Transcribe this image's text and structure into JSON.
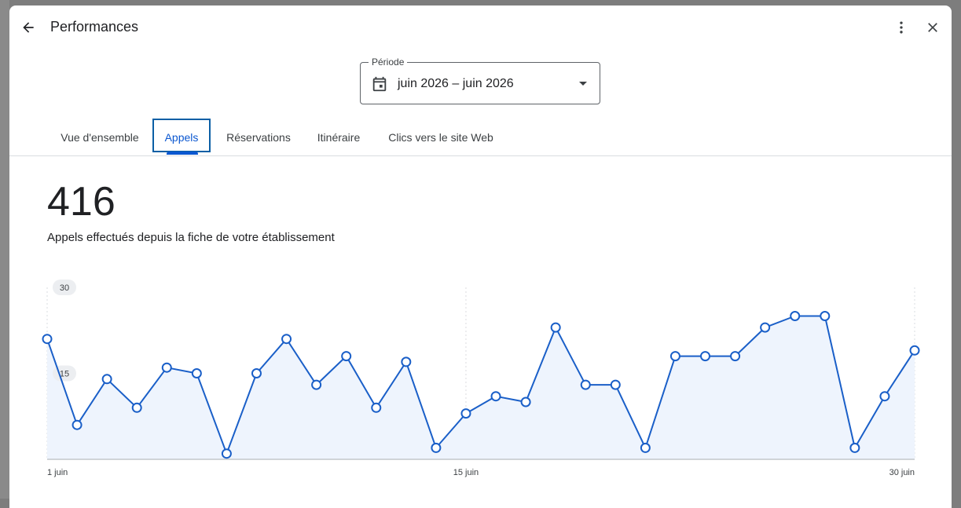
{
  "header": {
    "title": "Performances"
  },
  "period": {
    "label": "Période",
    "value": "juin 2026 – juin 2026"
  },
  "tabs": [
    {
      "label": "Vue d'ensemble",
      "active": false
    },
    {
      "label": "Appels",
      "active": true
    },
    {
      "label": "Réservations",
      "active": false
    },
    {
      "label": "Itinéraire",
      "active": false
    },
    {
      "label": "Clics vers le site Web",
      "active": false
    }
  ],
  "metric": {
    "value": "416",
    "description": "Appels effectués depuis la fiche de votre établissement"
  },
  "colors": {
    "accent": "#0b57d0",
    "line": "#1a5fc8",
    "fill": "#eef4fd"
  },
  "chart_data": {
    "type": "area",
    "x": [
      1,
      2,
      3,
      4,
      5,
      6,
      7,
      8,
      9,
      10,
      11,
      12,
      13,
      14,
      15,
      16,
      17,
      18,
      19,
      20,
      21,
      22,
      23,
      24,
      25,
      26,
      27,
      28,
      29,
      30
    ],
    "values": [
      21,
      6,
      14,
      9,
      16,
      15,
      1,
      15,
      21,
      13,
      18,
      9,
      17,
      2,
      8,
      11,
      10,
      23,
      13,
      13,
      2,
      18,
      18,
      18,
      23,
      25,
      25,
      2,
      11,
      19
    ],
    "ylim": [
      0,
      30
    ],
    "y_ticks": [
      "30",
      "15"
    ],
    "x_ticks": [
      {
        "day": 1,
        "label": "1 juin"
      },
      {
        "day": 15,
        "label": "15 juin"
      },
      {
        "day": 30,
        "label": "30 juin"
      }
    ],
    "grid": true
  }
}
